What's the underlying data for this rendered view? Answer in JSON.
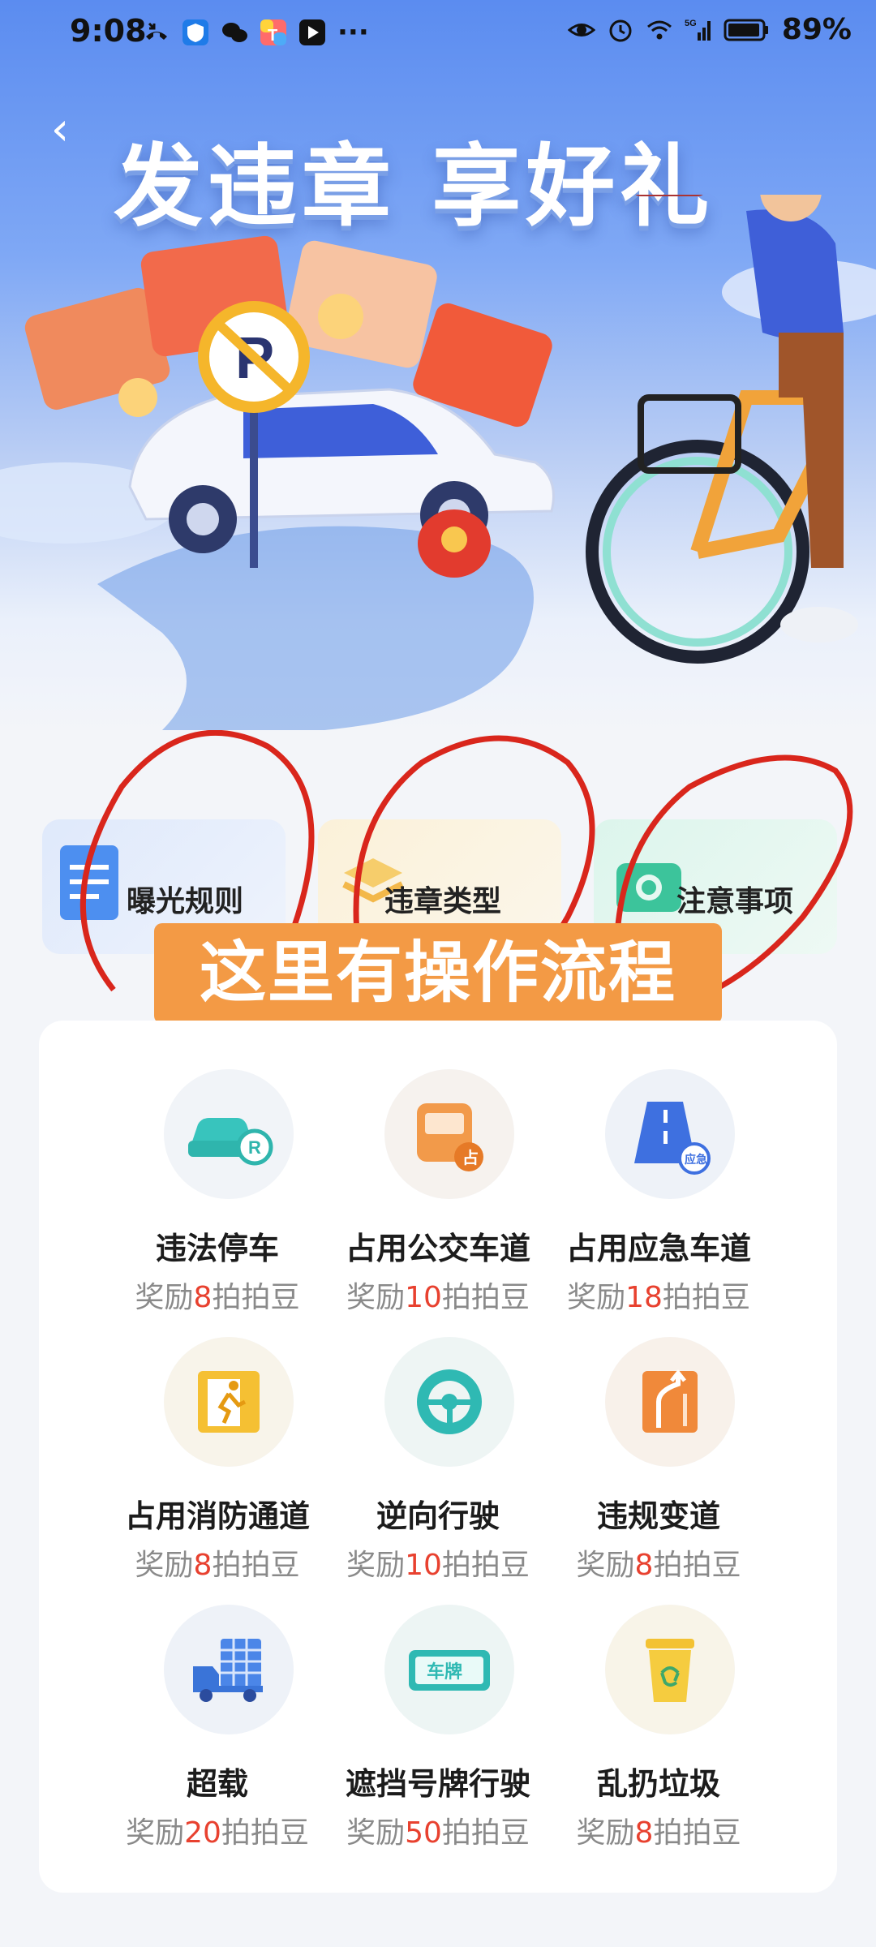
{
  "status_bar": {
    "time": "9:08",
    "dots": "···",
    "battery": "89%",
    "network": "5G"
  },
  "header": {
    "back_glyph": "‹",
    "title": "发违章 享好礼"
  },
  "tabs": [
    {
      "label": "曝光规则",
      "icon": "document-icon"
    },
    {
      "label": "违章类型",
      "icon": "stack-icon"
    },
    {
      "label": "注意事项",
      "icon": "camera-icon"
    }
  ],
  "overlay_note": "这里有操作流程",
  "violations": [
    {
      "name": "违法停车",
      "reward_prefix": "奖励",
      "reward_num": "8",
      "reward_suffix": "拍拍豆",
      "icon": "illegal-parking-icon"
    },
    {
      "name": "占用公交车道",
      "reward_prefix": "奖励",
      "reward_num": "10",
      "reward_suffix": "拍拍豆",
      "icon": "bus-lane-icon"
    },
    {
      "name": "占用应急车道",
      "reward_prefix": "奖励",
      "reward_num": "18",
      "reward_suffix": "拍拍豆",
      "icon": "emergency-lane-icon"
    },
    {
      "name": "占用消防通道",
      "reward_prefix": "奖励",
      "reward_num": "8",
      "reward_suffix": "拍拍豆",
      "icon": "fire-exit-icon"
    },
    {
      "name": "逆向行驶",
      "reward_prefix": "奖励",
      "reward_num": "10",
      "reward_suffix": "拍拍豆",
      "icon": "steering-wheel-icon"
    },
    {
      "name": "违规变道",
      "reward_prefix": "奖励",
      "reward_num": "8",
      "reward_suffix": "拍拍豆",
      "icon": "lane-change-icon"
    },
    {
      "name": "超载",
      "reward_prefix": "奖励",
      "reward_num": "20",
      "reward_suffix": "拍拍豆",
      "icon": "overload-truck-icon"
    },
    {
      "name": "遮挡号牌行驶",
      "reward_prefix": "奖励",
      "reward_num": "50",
      "reward_suffix": "拍拍豆",
      "icon": "license-plate-icon",
      "icon_text": "车牌"
    },
    {
      "name": "乱扔垃圾",
      "reward_prefix": "奖励",
      "reward_num": "8",
      "reward_suffix": "拍拍豆",
      "icon": "trash-bin-icon"
    }
  ],
  "art_labels": {
    "parking_sign": "P"
  },
  "colors": {
    "accent_red": "#e8412f",
    "overlay_orange": "#f39a45",
    "annotation_red": "#d9261c"
  }
}
